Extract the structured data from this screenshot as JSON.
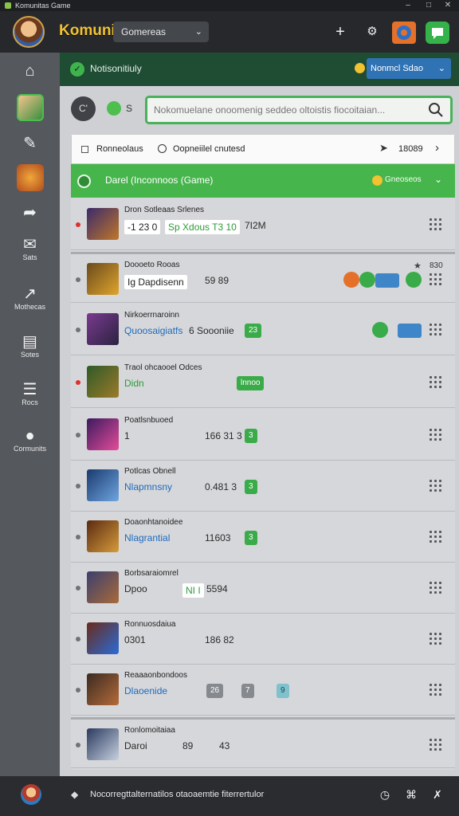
{
  "window": {
    "title": "Komunitas Game"
  },
  "app": {
    "title": "Komunitas",
    "dropdown_label": "Gomereas",
    "icons": [
      "plus-icon",
      "settings-icon",
      "orange-app-icon",
      "chat-icon"
    ]
  },
  "sidebar": {
    "items": [
      {
        "key": "home",
        "label": "",
        "icon": "home-icon"
      },
      {
        "key": "profile",
        "label": "",
        "icon": "profile-avatar"
      },
      {
        "key": "edit",
        "label": "",
        "icon": "edit-icon"
      },
      {
        "key": "game",
        "label": "",
        "icon": "game-art"
      },
      {
        "key": "share",
        "label": "",
        "icon": "share-icon"
      },
      {
        "key": "stats",
        "label": "Sats",
        "icon": "stats-icon"
      },
      {
        "key": "trends",
        "label": "Mothecas",
        "icon": "trend-icon"
      },
      {
        "key": "guide",
        "label": "Sotes",
        "icon": "document-icon"
      },
      {
        "key": "posts",
        "label": "Rocs",
        "icon": "list-icon"
      },
      {
        "key": "community",
        "label": "Cormunits",
        "icon": "chat-bubble-icon"
      }
    ]
  },
  "header": {
    "title": "Notisonitiuly",
    "dropdown_label": "Nonmcl Sdao"
  },
  "search": {
    "circle_label": "C'",
    "dot_label": "S",
    "placeholder": "Nokomuelane onoomenig seddeo oltoistis fiocoitaian..."
  },
  "sortbar": {
    "label_1": "Ronneolaus",
    "label_2": "Oopneiilel cnutesd",
    "count": "18089"
  },
  "group": {
    "title": "Darel (Inconnoos (Game)",
    "tag": "Gneoseos"
  },
  "rows": [
    {
      "name": "Dron Sotleaas Srlenes",
      "sub": "-1 23 0",
      "sub2": "Sp Xdous T3 10",
      "stat": "7I2M",
      "status": "red",
      "thumb": [
        "#3b2a6b",
        "#c0762a"
      ]
    },
    {
      "name": "Doooeto Rooas",
      "sub": "Ig Dapdisenn",
      "stat": "59 89",
      "star": "830",
      "status": "gray",
      "thumb": [
        "#6a4a1e",
        "#e0a52c"
      ],
      "actions": [
        "orange-circle",
        "green-circle",
        "blue-chip",
        "green-circle"
      ]
    },
    {
      "name": "Nirkoerrnaroinn",
      "sub": "Quoosaigiatfs",
      "stat": "6 Soooniie",
      "badge": "23",
      "status": "gray",
      "thumb": [
        "#7a3a8f",
        "#2a2340"
      ],
      "actions": [
        "green-circle",
        "blue-chip"
      ]
    },
    {
      "name": "Traol ohcaooel Odces",
      "sub": "Didn",
      "badge": "lnnoo",
      "status": "red",
      "thumb": [
        "#2f5a28",
        "#9c7a2a"
      ]
    },
    {
      "name": "Poatlsnbuoed",
      "sub": "1",
      "stat": "166 31 3",
      "badge": "3",
      "status": "gray",
      "thumb": [
        "#3b1a5e",
        "#e44c9a"
      ]
    },
    {
      "name": "Potlcas Obnell",
      "sub": "Nlapmnsny",
      "stat": "0.481 3",
      "badge": "3",
      "status": "gray",
      "thumb": [
        "#1a3a6e",
        "#6fa5e0"
      ]
    },
    {
      "name": "Doaonhtanoidee",
      "sub": "Nlagrantial",
      "stat": "11603",
      "badge": "3",
      "status": "gray",
      "thumb": [
        "#5a2a12",
        "#d69b3a"
      ]
    },
    {
      "name": "Borbsaraiomrel",
      "sub": "Dpoo",
      "stat": "5594",
      "sub2": "NI I",
      "status": "gray",
      "thumb": [
        "#3a3f6e",
        "#a96a3a"
      ]
    },
    {
      "name": "Ronnuosdaiua",
      "sub": "0301",
      "stat": "186 82",
      "status": "gray",
      "thumb": [
        "#6a2a1a",
        "#2a6bd8"
      ]
    },
    {
      "name": "Reaaaonbondoos",
      "sub": "Dlaoenide",
      "badges": [
        "26",
        "7",
        "9"
      ],
      "status": "gray",
      "thumb": [
        "#3a2a22",
        "#b56b3a"
      ]
    },
    {
      "name": "Ronlomoitaiaa",
      "sub": "Daroi",
      "stat": "89",
      "stat2": "43",
      "status": "gray",
      "thumb": [
        "#2a3a5e",
        "#c7d0e0"
      ]
    }
  ],
  "footer": {
    "text": "Nocorregttalternatilos otaoaemtie fiterrertulor"
  }
}
